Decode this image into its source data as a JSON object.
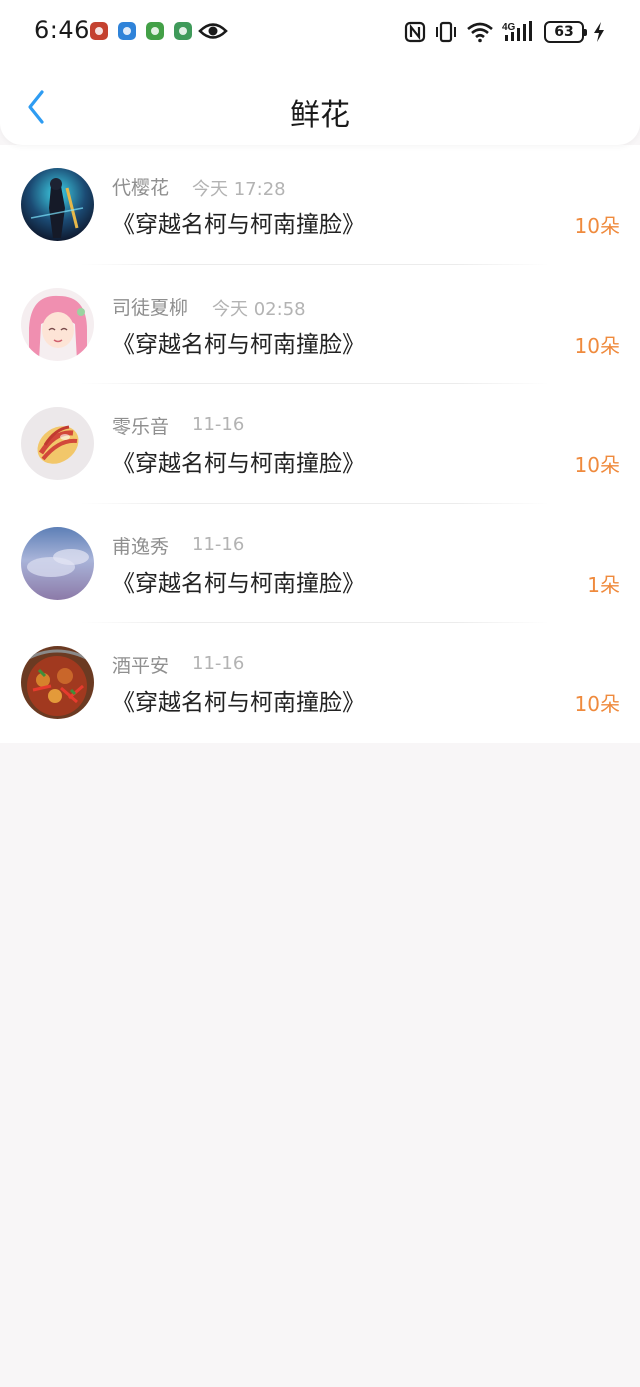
{
  "status_bar": {
    "time": "6:46",
    "battery": "63",
    "network": "4G"
  },
  "header": {
    "title": "鲜花"
  },
  "items": [
    {
      "name": "代樱花",
      "date": "今天 17:28",
      "book": "《穿越名柯与柯南撞脸》",
      "count": "10朵",
      "avatar": "avatar-dark-anime-figure"
    },
    {
      "name": "司徒夏柳",
      "date": "今天 02:58",
      "book": "《穿越名柯与柯南撞脸》",
      "count": "10朵",
      "avatar": "avatar-pink-hair-anime-girl"
    },
    {
      "name": "零乐音",
      "date": "11-16",
      "book": "《穿越名柯与柯南撞脸》",
      "count": "10朵",
      "avatar": "avatar-striped-shell"
    },
    {
      "name": "甫逸秀",
      "date": "11-16",
      "book": "《穿越名柯与柯南撞脸》",
      "count": "1朵",
      "avatar": "avatar-cloudy-sky"
    },
    {
      "name": "酒平安",
      "date": "11-16",
      "book": "《穿越名柯与柯南撞脸》",
      "count": "10朵",
      "avatar": "avatar-spicy-food"
    }
  ],
  "colors": {
    "accent_back": "#2e9cf2",
    "count": "#ef8a3d",
    "name": "#8f8f8f",
    "date": "#b3b3b3"
  }
}
